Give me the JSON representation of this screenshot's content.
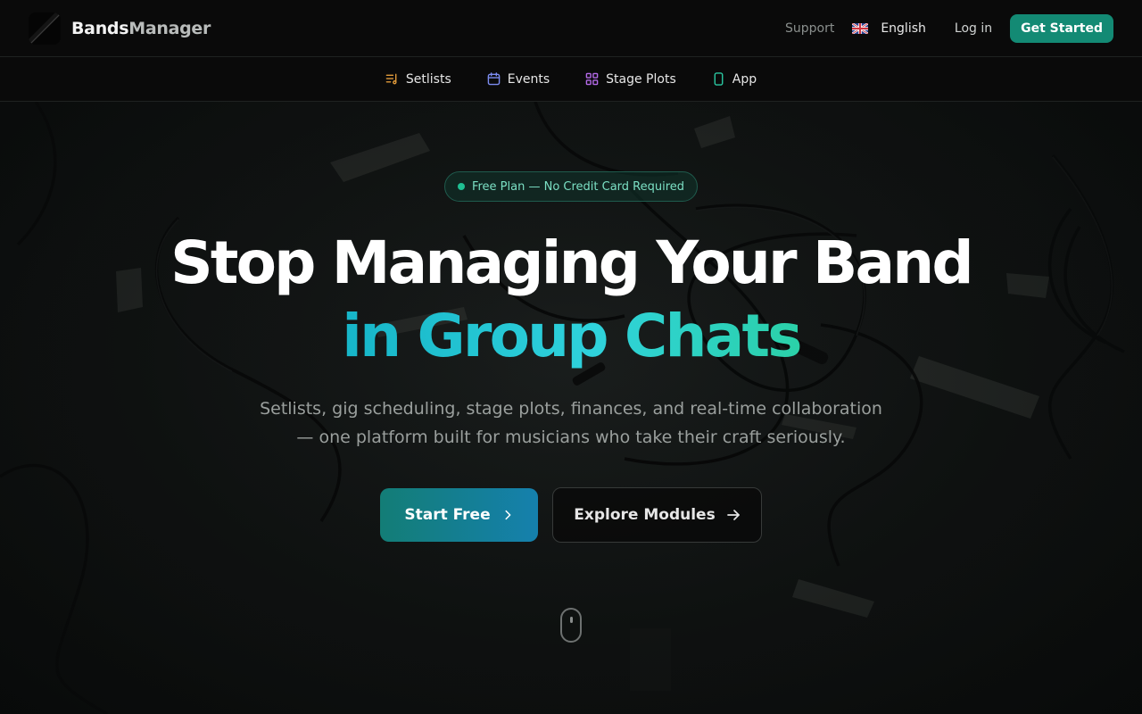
{
  "header": {
    "brand_part1": "Bands",
    "brand_part2": "Manager",
    "support": "Support",
    "language": "English",
    "login": "Log in",
    "get_started": "Get Started"
  },
  "modules": [
    {
      "label": "Setlists",
      "icon": "setlist-icon",
      "color": "#e09a3a"
    },
    {
      "label": "Events",
      "icon": "calendar-icon",
      "color": "#7c8cf0"
    },
    {
      "label": "Stage Plots",
      "icon": "grid-icon",
      "color": "#b46ae8"
    },
    {
      "label": "App",
      "icon": "smartphone-icon",
      "color": "#2ac7a1"
    }
  ],
  "hero": {
    "badge": "Free Plan — No Credit Card Required",
    "headline_line1": "Stop Managing Your Band",
    "headline_line2": "in Group Chats",
    "subcopy_line1": "Setlists, gig scheduling, stage plots, finances, and real-time collaboration",
    "subcopy_line2": "— one platform built for musicians who take their craft seriously.",
    "primary_cta": "Start Free",
    "secondary_cta": "Explore Modules"
  },
  "colors": {
    "accent": "#138a74",
    "headline_gradient_start": "#16b5c8",
    "headline_gradient_end": "#2bd1a8"
  }
}
